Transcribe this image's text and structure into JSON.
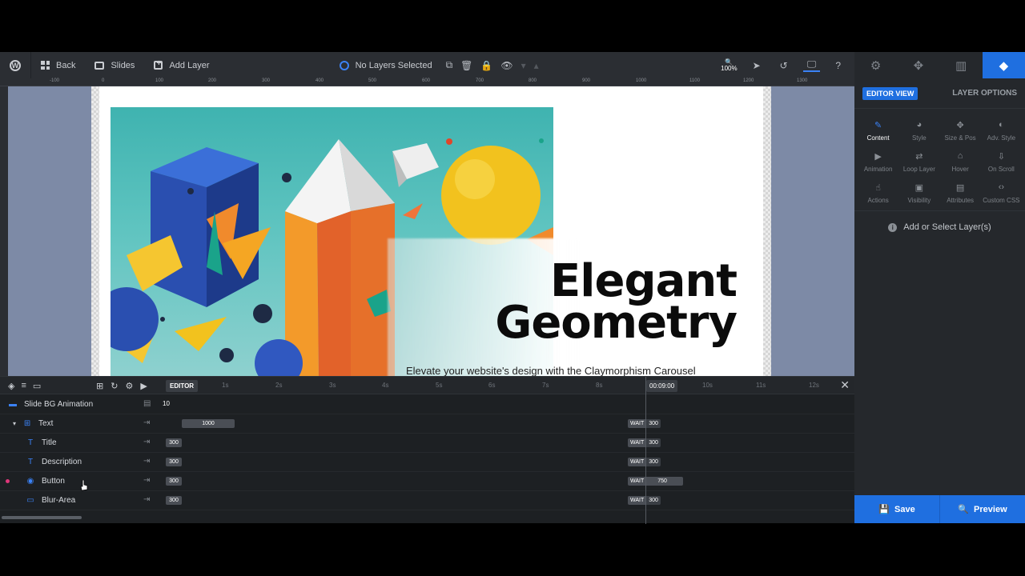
{
  "toolbar": {
    "wp_logo": "W",
    "back_label": "Back",
    "slides_label": "Slides",
    "add_layer_label": "Add Layer",
    "layer_status": "No Layers Selected",
    "zoom": "100%"
  },
  "right_panel": {
    "editor_view": "EDITOR VIEW",
    "layer_options": "LAYER OPTIONS",
    "options": [
      {
        "label": "Content",
        "icon": "pencil-icon",
        "glyph": "✎"
      },
      {
        "label": "Style",
        "icon": "palette-icon",
        "glyph": "◕"
      },
      {
        "label": "Size & Pos",
        "icon": "move-icon",
        "glyph": "✥"
      },
      {
        "label": "Adv. Style",
        "icon": "contrast-icon",
        "glyph": "◐"
      },
      {
        "label": "Animation",
        "icon": "play-icon",
        "glyph": "▶"
      },
      {
        "label": "Loop Layer",
        "icon": "loop-icon",
        "glyph": "⇄"
      },
      {
        "label": "Hover",
        "icon": "mouse-icon",
        "glyph": "⌂"
      },
      {
        "label": "On Scroll",
        "icon": "scroll-icon",
        "glyph": "⇩"
      },
      {
        "label": "Actions",
        "icon": "hand-icon",
        "glyph": "☝"
      },
      {
        "label": "Visibility",
        "icon": "visibility-icon",
        "glyph": "▣"
      },
      {
        "label": "Attributes",
        "icon": "document-icon",
        "glyph": "▤"
      },
      {
        "label": "Custom CSS",
        "icon": "code-icon",
        "glyph": "‹›"
      }
    ],
    "empty_message": "Add or Select Layer(s)",
    "save_label": "Save",
    "preview_label": "Preview"
  },
  "ruler": [
    "-100",
    "0",
    "100",
    "200",
    "300",
    "400",
    "500",
    "600",
    "700",
    "800",
    "900",
    "1000",
    "1100",
    "1200",
    "1300"
  ],
  "slide": {
    "headline_line1": "Elegant",
    "headline_line2": "Geometry",
    "subline": "Elevate your website's design with the Claymorphism Carousel"
  },
  "timeline": {
    "editor_tag": "EDITOR",
    "seconds": [
      "1s",
      "2s",
      "3s",
      "4s",
      "5s",
      "6s",
      "7s",
      "8s",
      "10s",
      "11s",
      "12s"
    ],
    "current_time": "00:09:00",
    "bg_row": {
      "label": "Slide BG Animation",
      "value": "10"
    },
    "rows": [
      {
        "label": "Text",
        "start": "1000",
        "wait": "WAIT",
        "end": "300"
      },
      {
        "label": "Title",
        "start": "300",
        "wait": "WAIT",
        "end": "300"
      },
      {
        "label": "Description",
        "start": "300",
        "wait": "WAIT",
        "end": "300"
      },
      {
        "label": "Button",
        "start": "300",
        "wait": "WAIT",
        "end": "750"
      },
      {
        "label": "Blur-Area",
        "start": "300",
        "wait": "WAIT",
        "end": "300"
      }
    ]
  },
  "colors": {
    "accent": "#1f6fe0",
    "canvas_bg": "#7d8aa6",
    "panel_bg": "#25282c"
  }
}
